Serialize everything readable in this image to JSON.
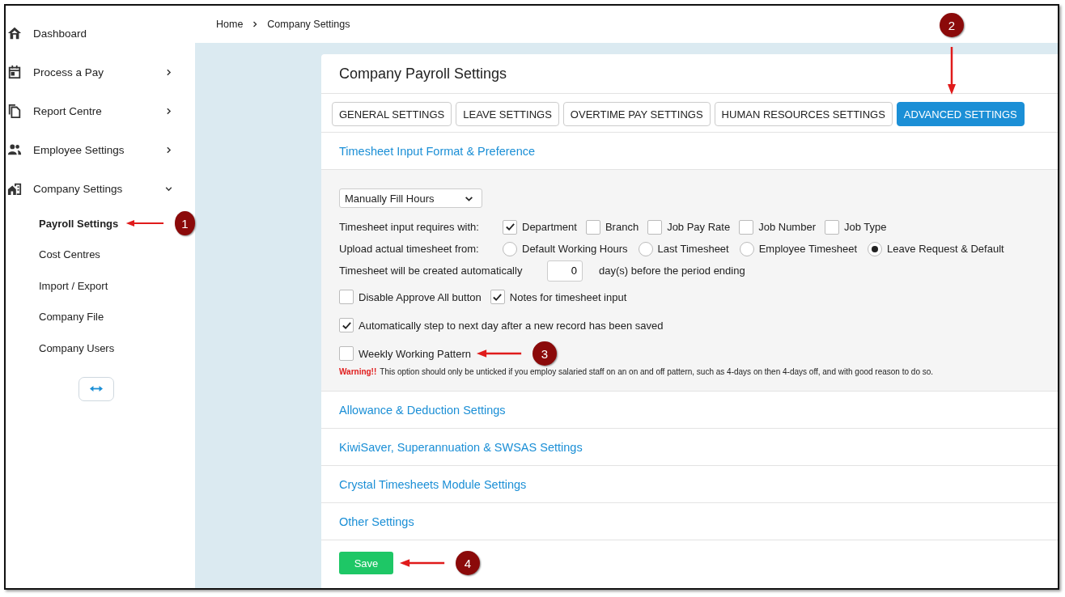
{
  "sidebar": {
    "items": [
      {
        "label": "Dashboard",
        "kind": "home"
      },
      {
        "label": "Process a Pay",
        "kind": "calendar",
        "expanded": false
      },
      {
        "label": "Report Centre",
        "kind": "document",
        "expanded": false
      },
      {
        "label": "Employee Settings",
        "kind": "people",
        "expanded": false
      },
      {
        "label": "Company Settings",
        "kind": "building",
        "expanded": true,
        "children": [
          {
            "label": "Payroll Settings",
            "selected": true,
            "callout": "1"
          },
          {
            "label": "Cost Centres",
            "selected": false
          },
          {
            "label": "Import / Export",
            "selected": false
          },
          {
            "label": "Company File",
            "selected": false
          },
          {
            "label": "Company Users",
            "selected": false
          }
        ]
      }
    ]
  },
  "breadcrumb": [
    "Home",
    "Company Settings"
  ],
  "card": {
    "title": "Company Payroll Settings",
    "tabs": [
      {
        "label": "GENERAL SETTINGS",
        "selected": false
      },
      {
        "label": "LEAVE SETTINGS",
        "selected": false
      },
      {
        "label": "OVERTIME PAY SETTINGS",
        "selected": false
      },
      {
        "label": "HUMAN RESOURCES SETTINGS",
        "selected": false
      },
      {
        "label": "ADVANCED SETTINGS",
        "selected": true,
        "callout": "2"
      }
    ],
    "sections": [
      {
        "title": "Timesheet Input Format & Preference"
      },
      {
        "title": "Allowance & Deduction Settings"
      },
      {
        "title": "KiwiSaver, Superannuation & SWSAS Settings"
      },
      {
        "title": "Crystal Timesheets Module Settings"
      },
      {
        "title": "Other Settings"
      }
    ],
    "timesheet_panel": {
      "format_select": "Manually Fill Hours",
      "requires": {
        "label": "Timesheet input requires with:",
        "options": [
          {
            "label": "Department",
            "checked": true
          },
          {
            "label": "Branch",
            "checked": false
          },
          {
            "label": "Job Pay Rate",
            "checked": false
          },
          {
            "label": "Job Number",
            "checked": false
          },
          {
            "label": "Job Type",
            "checked": false
          }
        ]
      },
      "upload": {
        "label": "Upload actual timesheet from:",
        "options": [
          {
            "label": "Default Working Hours",
            "selected": false
          },
          {
            "label": "Last Timesheet",
            "selected": false
          },
          {
            "label": "Employee Timesheet",
            "selected": false
          },
          {
            "label": "Leave Request & Default",
            "selected": true
          }
        ]
      },
      "auto_create": {
        "label": "Timesheet will be created automatically",
        "value": "0",
        "suffix": "day(s) before the period ending"
      },
      "check_rows": [
        [
          {
            "label": "Disable Approve All button",
            "checked": false
          },
          {
            "label": "Notes for timesheet input",
            "checked": true
          }
        ],
        [
          {
            "label": "Automatically step to next day after a new record has been saved",
            "checked": true
          }
        ],
        [
          {
            "label": "Weekly Working Pattern",
            "checked": false,
            "callout": "3"
          }
        ]
      ],
      "warning_label": "Warning!!",
      "warning_text": "This option should only be unticked if you employ salaried staff on an on and off pattern, such as 4-days on then 4-days off, and with good reason to do so."
    },
    "save_button": {
      "label": "Save",
      "callout": "4"
    }
  }
}
